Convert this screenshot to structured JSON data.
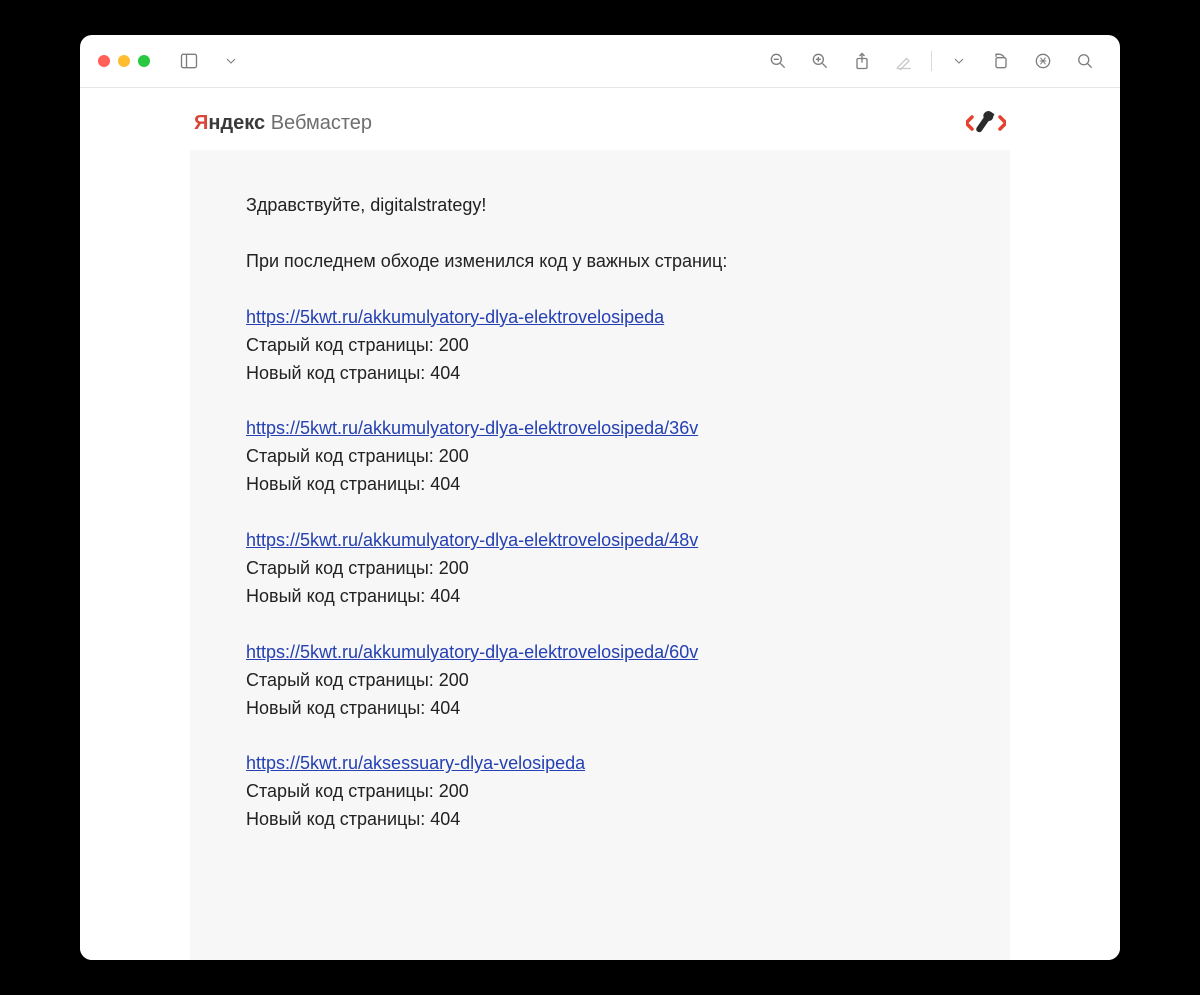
{
  "brand": {
    "ya": "Я",
    "ndex": "ндекс",
    "wm": " Вебмастер"
  },
  "greeting": "Здравствуйте, digitalstrategy!",
  "intro": "При последнем обходе изменился код у важных страниц:",
  "old_code_label": "Старый код страницы:",
  "new_code_label": "Новый код страницы:",
  "entries": [
    {
      "url": "https://5kwt.ru/akkumulyatory-dlya-elektrovelosipeda",
      "old_code": "200",
      "new_code": "404"
    },
    {
      "url": "https://5kwt.ru/akkumulyatory-dlya-elektrovelosipeda/36v",
      "old_code": "200",
      "new_code": "404"
    },
    {
      "url": "https://5kwt.ru/akkumulyatory-dlya-elektrovelosipeda/48v",
      "old_code": "200",
      "new_code": "404"
    },
    {
      "url": "https://5kwt.ru/akkumulyatory-dlya-elektrovelosipeda/60v",
      "old_code": "200",
      "new_code": "404"
    },
    {
      "url": "https://5kwt.ru/aksessuary-dlya-velosipeda",
      "old_code": "200",
      "new_code": "404"
    }
  ]
}
